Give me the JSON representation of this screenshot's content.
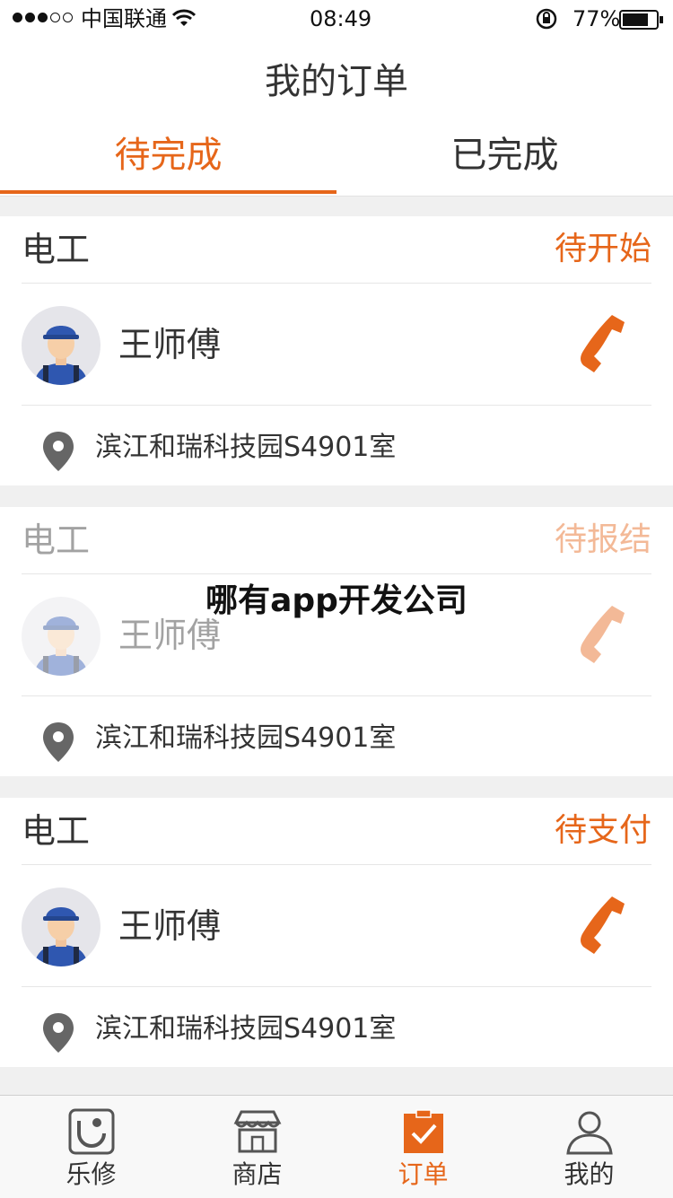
{
  "status_bar": {
    "carrier": "中国联通",
    "time": "08:49",
    "battery": "77%"
  },
  "header": {
    "title": "我的订单"
  },
  "tabs": [
    {
      "label": "待完成",
      "active": true
    },
    {
      "label": "已完成",
      "active": false
    }
  ],
  "orders": [
    {
      "service": "电工",
      "status": "待开始",
      "technician": "王师傅",
      "address": "滨江和瑞科技园S4901室"
    },
    {
      "service": "电工",
      "status": "待报结",
      "technician": "王师傅",
      "address": "滨江和瑞科技园S4901室"
    },
    {
      "service": "电工",
      "status": "待支付",
      "technician": "王师傅",
      "address": "滨江和瑞科技园S4901室"
    }
  ],
  "overlay": {
    "watermark": "哪有app开发公司"
  },
  "tab_bar": [
    {
      "label": "乐修",
      "icon": "lexiu-logo-icon"
    },
    {
      "label": "商店",
      "icon": "store-icon"
    },
    {
      "label": "订单",
      "icon": "order-clipboard-icon",
      "active": true
    },
    {
      "label": "我的",
      "icon": "profile-icon"
    }
  ],
  "colors": {
    "accent": "#e6661a",
    "text": "#333333",
    "background": "#f0f0f0"
  }
}
